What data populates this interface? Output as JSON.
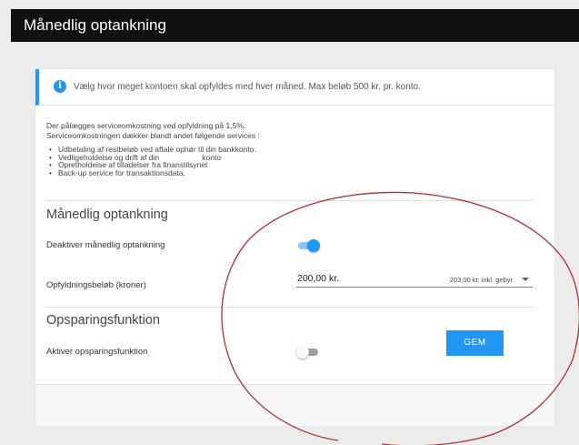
{
  "header": {
    "title": "Månedlig optankning"
  },
  "info": {
    "icon": "info-icon",
    "text": "Vælg hvor meget kontoen skal opfyldes med hver måned. Max beløb 500 kr. pr. konto."
  },
  "description": {
    "line1": "Der pålægges serviceomkostning ved opfyldning på 1,5%.",
    "line2": "Serviceomkostningen dækker blandt andet følgende services :",
    "items": [
      "Udbetaling af restbeløb ved aftale ophør til din bankkonto.",
      "Vedligeholdelse og drift af din                    konto",
      "Opretholdelse af tilladelser fra finanstilsynet",
      "Back-up service for transaktionsdata."
    ]
  },
  "monthly": {
    "title": "Månedlig optankning",
    "toggle_label": "Deaktiver månedlig optankning",
    "toggle_on": true,
    "amount_label": "Opfyldningsbeløb (kroner)",
    "amount_value": "200,00 kr.",
    "amount_extra": "203,00 kr. inkl. gebyr"
  },
  "savings": {
    "title": "Opsparingsfunktion",
    "toggle_label": "Aktiver opsparingsfunktion",
    "toggle_on": false
  },
  "footer": {
    "save_label": "GEM"
  },
  "colors": {
    "accent": "#2196f3",
    "annotation": "#b03030",
    "topbar": "#111111"
  }
}
